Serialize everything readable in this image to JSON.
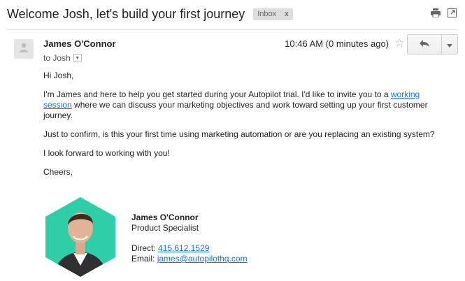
{
  "email": {
    "subject": "Welcome Josh, let's build your first journey",
    "label": "Inbox",
    "label_remove": "x",
    "sender_name": "James O'Connor",
    "to_label": "to Josh",
    "time": "10:46 AM (0 minutes ago)",
    "body": {
      "greeting": "Hi Josh,",
      "p1_before": "I'm James and here to help you get started during your Autopilot trial. I'd like to invite you to a ",
      "p1_link": "working session",
      "p1_after": " where we can discuss your marketing objectives and work toward setting up your first customer journey.",
      "p2": "Just to confirm, is this your first time using marketing automation or are you replacing an existing system?",
      "p3": "I look forward to working with you!",
      "closing": "Cheers,"
    },
    "signature": {
      "name": "James O'Connor",
      "title": "Product Specialist",
      "direct_label": "Direct:",
      "phone": "415.612.1529",
      "email_label": "Email:",
      "email": "james@autopilothq.com"
    }
  },
  "icons": [
    "print-icon",
    "popout-icon",
    "person-icon",
    "dropdown-caret-icon",
    "star-icon",
    "reply-icon",
    "more-caret-icon"
  ],
  "colors": {
    "link": "#1a73e8",
    "hex_accent": "#2ecfa8",
    "label_bg": "#dddddd"
  }
}
